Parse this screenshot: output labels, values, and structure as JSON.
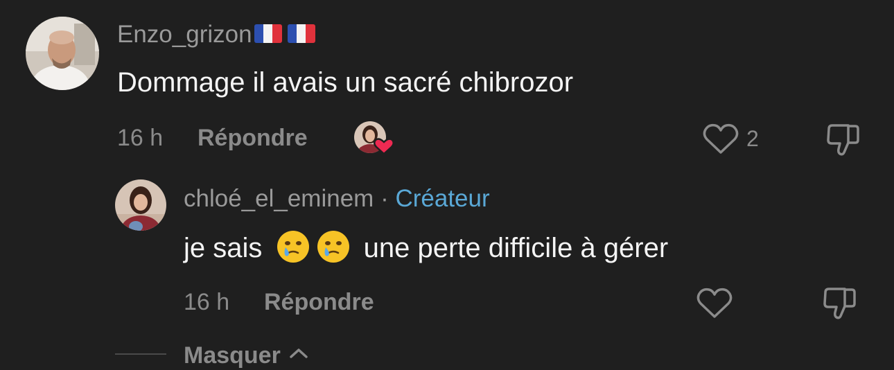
{
  "comment": {
    "username": "Enzo_grizon",
    "text": "Dommage il avais un sacré chibrozor",
    "time": "16 h",
    "reply_label": "Répondre",
    "like_count": "2",
    "flag_icon": "flag-france-icon",
    "liked_by_creator_icon": "creator-heart-avatar-icon"
  },
  "reply": {
    "username": "chloé_el_eminem",
    "separator": "·",
    "badge": "Créateur",
    "text_before": "je sais",
    "text_after": "une perte difficile à gérer",
    "emoji_icon": "face-holding-back-tears-icon",
    "time": "16 h",
    "reply_label": "Répondre"
  },
  "collapse": {
    "label": "Masquer",
    "icon": "chevron-up-icon"
  },
  "colors": {
    "background": "#1f1f1f",
    "creator_badge": "#5aa8d6",
    "heart_badge": "#ee2a52",
    "muted_text": "#8b8b8b"
  }
}
